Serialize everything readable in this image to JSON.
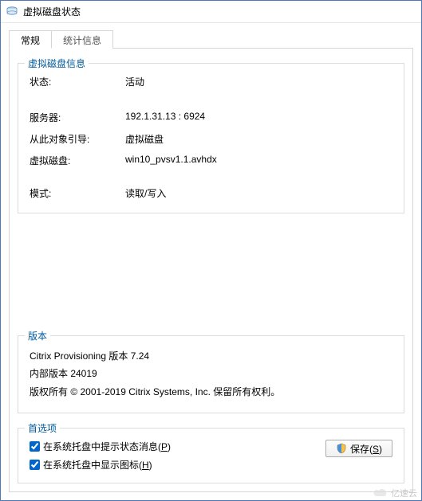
{
  "window": {
    "title": "虚拟磁盘状态"
  },
  "tabs": {
    "general": "常规",
    "stats": "统计信息"
  },
  "group_disk_info": {
    "title": "虚拟磁盘信息",
    "labels": {
      "status": "状态:",
      "server": "服务器:",
      "bootfrom": "从此对象引导:",
      "vdisk": "虚拟磁盘:",
      "mode": "模式:"
    },
    "values": {
      "status": "活动",
      "server": "192.1.31.13 : 6924",
      "bootfrom": "虚拟磁盘",
      "vdisk": "win10_pvsv1.1.avhdx",
      "mode": "读取/写入"
    }
  },
  "group_version": {
    "title": "版本",
    "product": "Citrix Provisioning 版本 7.24",
    "build": "内部版本 24019",
    "copyright": "版权所有 © 2001-2019 Citrix Systems, Inc. 保留所有权利。"
  },
  "group_prefs": {
    "title": "首选项",
    "checkbox1_prefix": "在系统托盘中提示状态消息(",
    "checkbox1_accel": "P",
    "checkbox1_suffix": ")",
    "checkbox2_prefix": "在系统托盘中显示图标(",
    "checkbox2_accel": "H",
    "checkbox2_suffix": ")",
    "save_prefix": "保存(",
    "save_accel": "S",
    "save_suffix": ")"
  },
  "watermark": "亿速云"
}
